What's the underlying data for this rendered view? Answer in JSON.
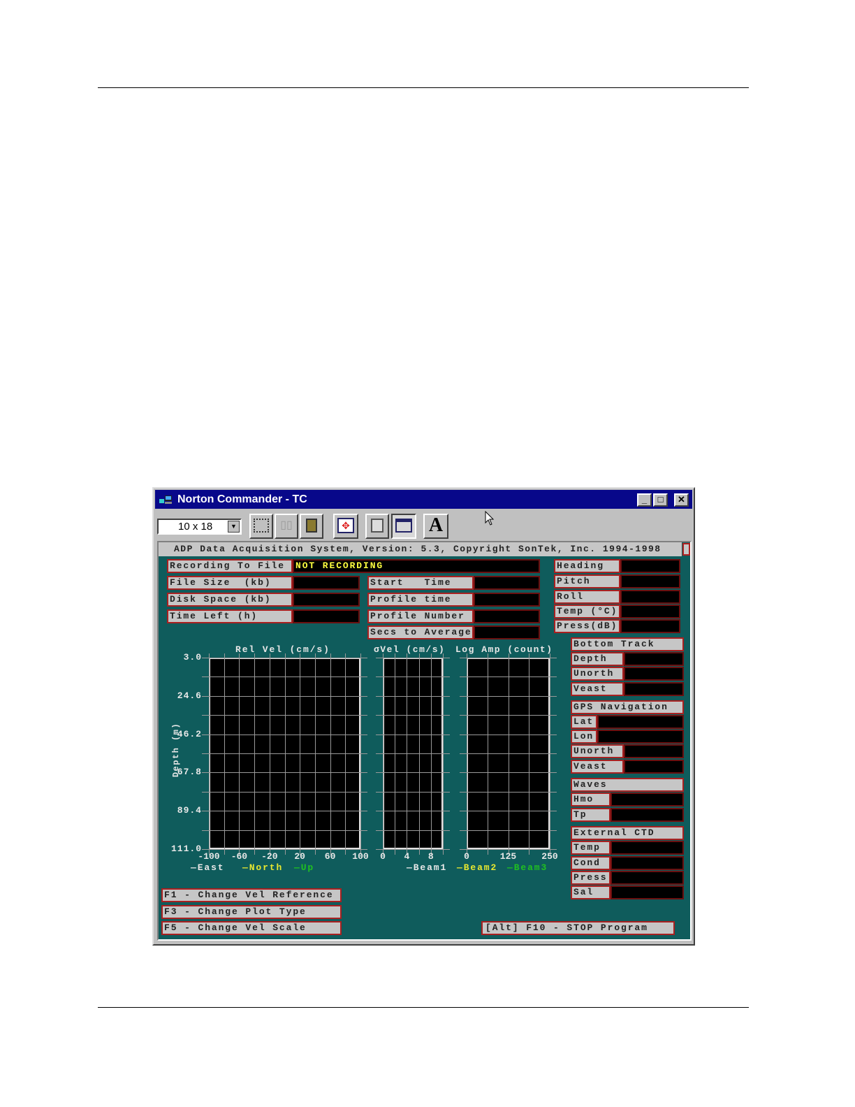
{
  "window": {
    "title": "Norton Commander - TC",
    "minimize": "_",
    "maximize": "□",
    "close": "✕"
  },
  "toolbar": {
    "font_size": "10 x 18",
    "buttons": [
      "mark-icon",
      "copy-icon",
      "paste-icon",
      "fullscreen-icon",
      "properties-icon",
      "background-icon",
      "font-icon"
    ],
    "font_button_label": "A"
  },
  "app": {
    "header": "ADP Data Acquisition System, Version: 5.3, Copyright SonTek, Inc. 1994-1998",
    "recording": {
      "label": "Recording To File",
      "value": "NOT RECORDING"
    },
    "left_fields": [
      {
        "label": "File Size  (kb)",
        "value": ""
      },
      {
        "label": "Disk Space (kb)",
        "value": ""
      },
      {
        "label": "Time Left (h)",
        "value": ""
      }
    ],
    "mid_fields": [
      {
        "label": "Start   Time",
        "value": ""
      },
      {
        "label": "Profile time",
        "value": ""
      },
      {
        "label": "Profile Number",
        "value": ""
      },
      {
        "label": "Secs to Average",
        "value": ""
      }
    ],
    "sensor_fields": [
      {
        "label": "Heading",
        "value": ""
      },
      {
        "label": "Pitch",
        "value": ""
      },
      {
        "label": "Roll",
        "value": ""
      },
      {
        "label": "Temp (°C)",
        "value": ""
      },
      {
        "label": "Press(dB)",
        "value": ""
      }
    ],
    "bottom_track": {
      "title": "Bottom Track",
      "fields": [
        {
          "label": "Depth",
          "value": ""
        },
        {
          "label": "Unorth",
          "value": ""
        },
        {
          "label": "Veast",
          "value": ""
        }
      ]
    },
    "gps": {
      "title": "GPS Navigation",
      "fields": [
        {
          "label": "Lat",
          "value": ""
        },
        {
          "label": "Lon",
          "value": ""
        },
        {
          "label": "Unorth",
          "value": ""
        },
        {
          "label": "Veast",
          "value": ""
        }
      ]
    },
    "waves": {
      "title": "Waves",
      "fields": [
        {
          "label": "Hmo",
          "value": ""
        },
        {
          "label": "Tp",
          "value": ""
        }
      ]
    },
    "ctd": {
      "title": "External CTD",
      "fields": [
        {
          "label": "Temp",
          "value": ""
        },
        {
          "label": "Cond",
          "value": ""
        },
        {
          "label": "Press",
          "value": ""
        },
        {
          "label": "Sal",
          "value": ""
        }
      ]
    },
    "function_keys": [
      "F1 - Change Vel Reference",
      "F3 - Change Plot Type",
      "F5 - Change Vel Scale"
    ],
    "stop": "[Alt] F10 - STOP Program"
  },
  "plots": {
    "ylabel": "Depth (m)",
    "yticks": [
      "3.0",
      "24.6",
      "46.2",
      "67.8",
      "89.4",
      "111.0"
    ],
    "ylim": [
      3.0,
      111.0
    ],
    "rel_vel": {
      "title": "Rel Vel (cm/s)",
      "xticks": [
        "-100",
        "-60",
        "-20",
        "20",
        "60",
        "100"
      ],
      "xlim": [
        -100,
        100
      ],
      "legend": [
        "—East",
        "—North",
        "—Up"
      ]
    },
    "sigma_vel": {
      "title": "σVel (cm/s)",
      "xticks": [
        "0",
        "4",
        "8"
      ],
      "xlim": [
        0,
        10
      ]
    },
    "log_amp": {
      "title": "Log Amp (count)",
      "xticks": [
        "0",
        "125",
        "250"
      ],
      "xlim": [
        0,
        250
      ],
      "legend": [
        "—Beam1",
        "—Beam2",
        "—Beam3"
      ]
    },
    "legend_colors": [
      "#e8e8e8",
      "#e8e830",
      "#20c020"
    ]
  },
  "colors": {
    "titlebar": "#08088a",
    "console_bg": "#0f5c5c",
    "value_text": "#ffff40"
  }
}
